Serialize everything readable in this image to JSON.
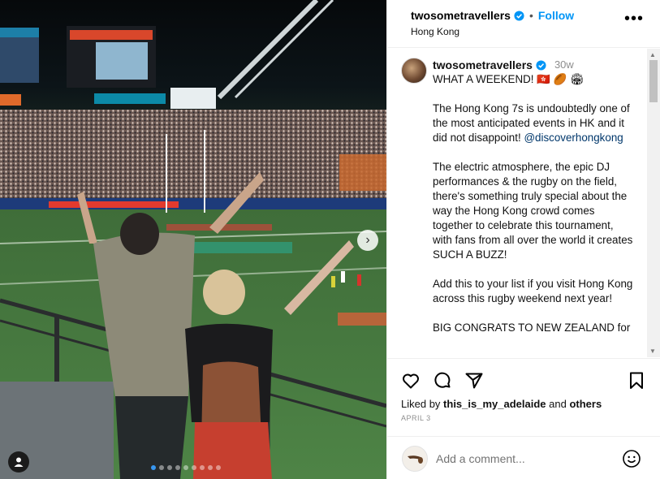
{
  "post": {
    "username": "twosometravellers",
    "follow_label": "Follow",
    "separator": "•",
    "location": "Hong Kong",
    "more_label": "•••"
  },
  "caption": {
    "username": "twosometravellers",
    "time_ago": "30w",
    "first_line": "WHAT A WEEKEND! 🇭🇰 🏉 🏟",
    "paragraph_1": "The Hong Kong 7s is undoubtedly one of the most anticipated events in HK and it did not disappoint!",
    "mention": "@discoverhongkong",
    "paragraph_2": "The electric atmosphere, the epic DJ performances & the rugby on the field, there's something truly special about the way the Hong Kong crowd comes together to celebrate this tournament, with fans from all over the world it creates SUCH A BUZZ!",
    "paragraph_3": "Add this to your list if you visit Hong Kong across this rugby weekend next year!",
    "paragraph_4": "BIG CONGRATS TO NEW ZEALAND for"
  },
  "engagement": {
    "liked_by_prefix": "Liked by",
    "liked_by_user": "this_is_my_adelaide",
    "liked_by_join": "and",
    "liked_by_others": "others",
    "date": "APRIL 3"
  },
  "comment": {
    "placeholder": "Add a comment..."
  },
  "carousel": {
    "slide_count": 9,
    "active_index": 0
  },
  "icons": {
    "verified": "verified-badge-icon",
    "like": "heart-icon",
    "comment": "comment-bubble-icon",
    "share": "paper-plane-icon",
    "save": "bookmark-icon",
    "emoji": "smiley-icon",
    "next": "chevron-right-icon",
    "tag": "user-tag-icon"
  },
  "colors": {
    "accent": "#0095f6",
    "verified": "#0095f6",
    "mention": "#00376b",
    "muted": "#8e8e8e"
  }
}
